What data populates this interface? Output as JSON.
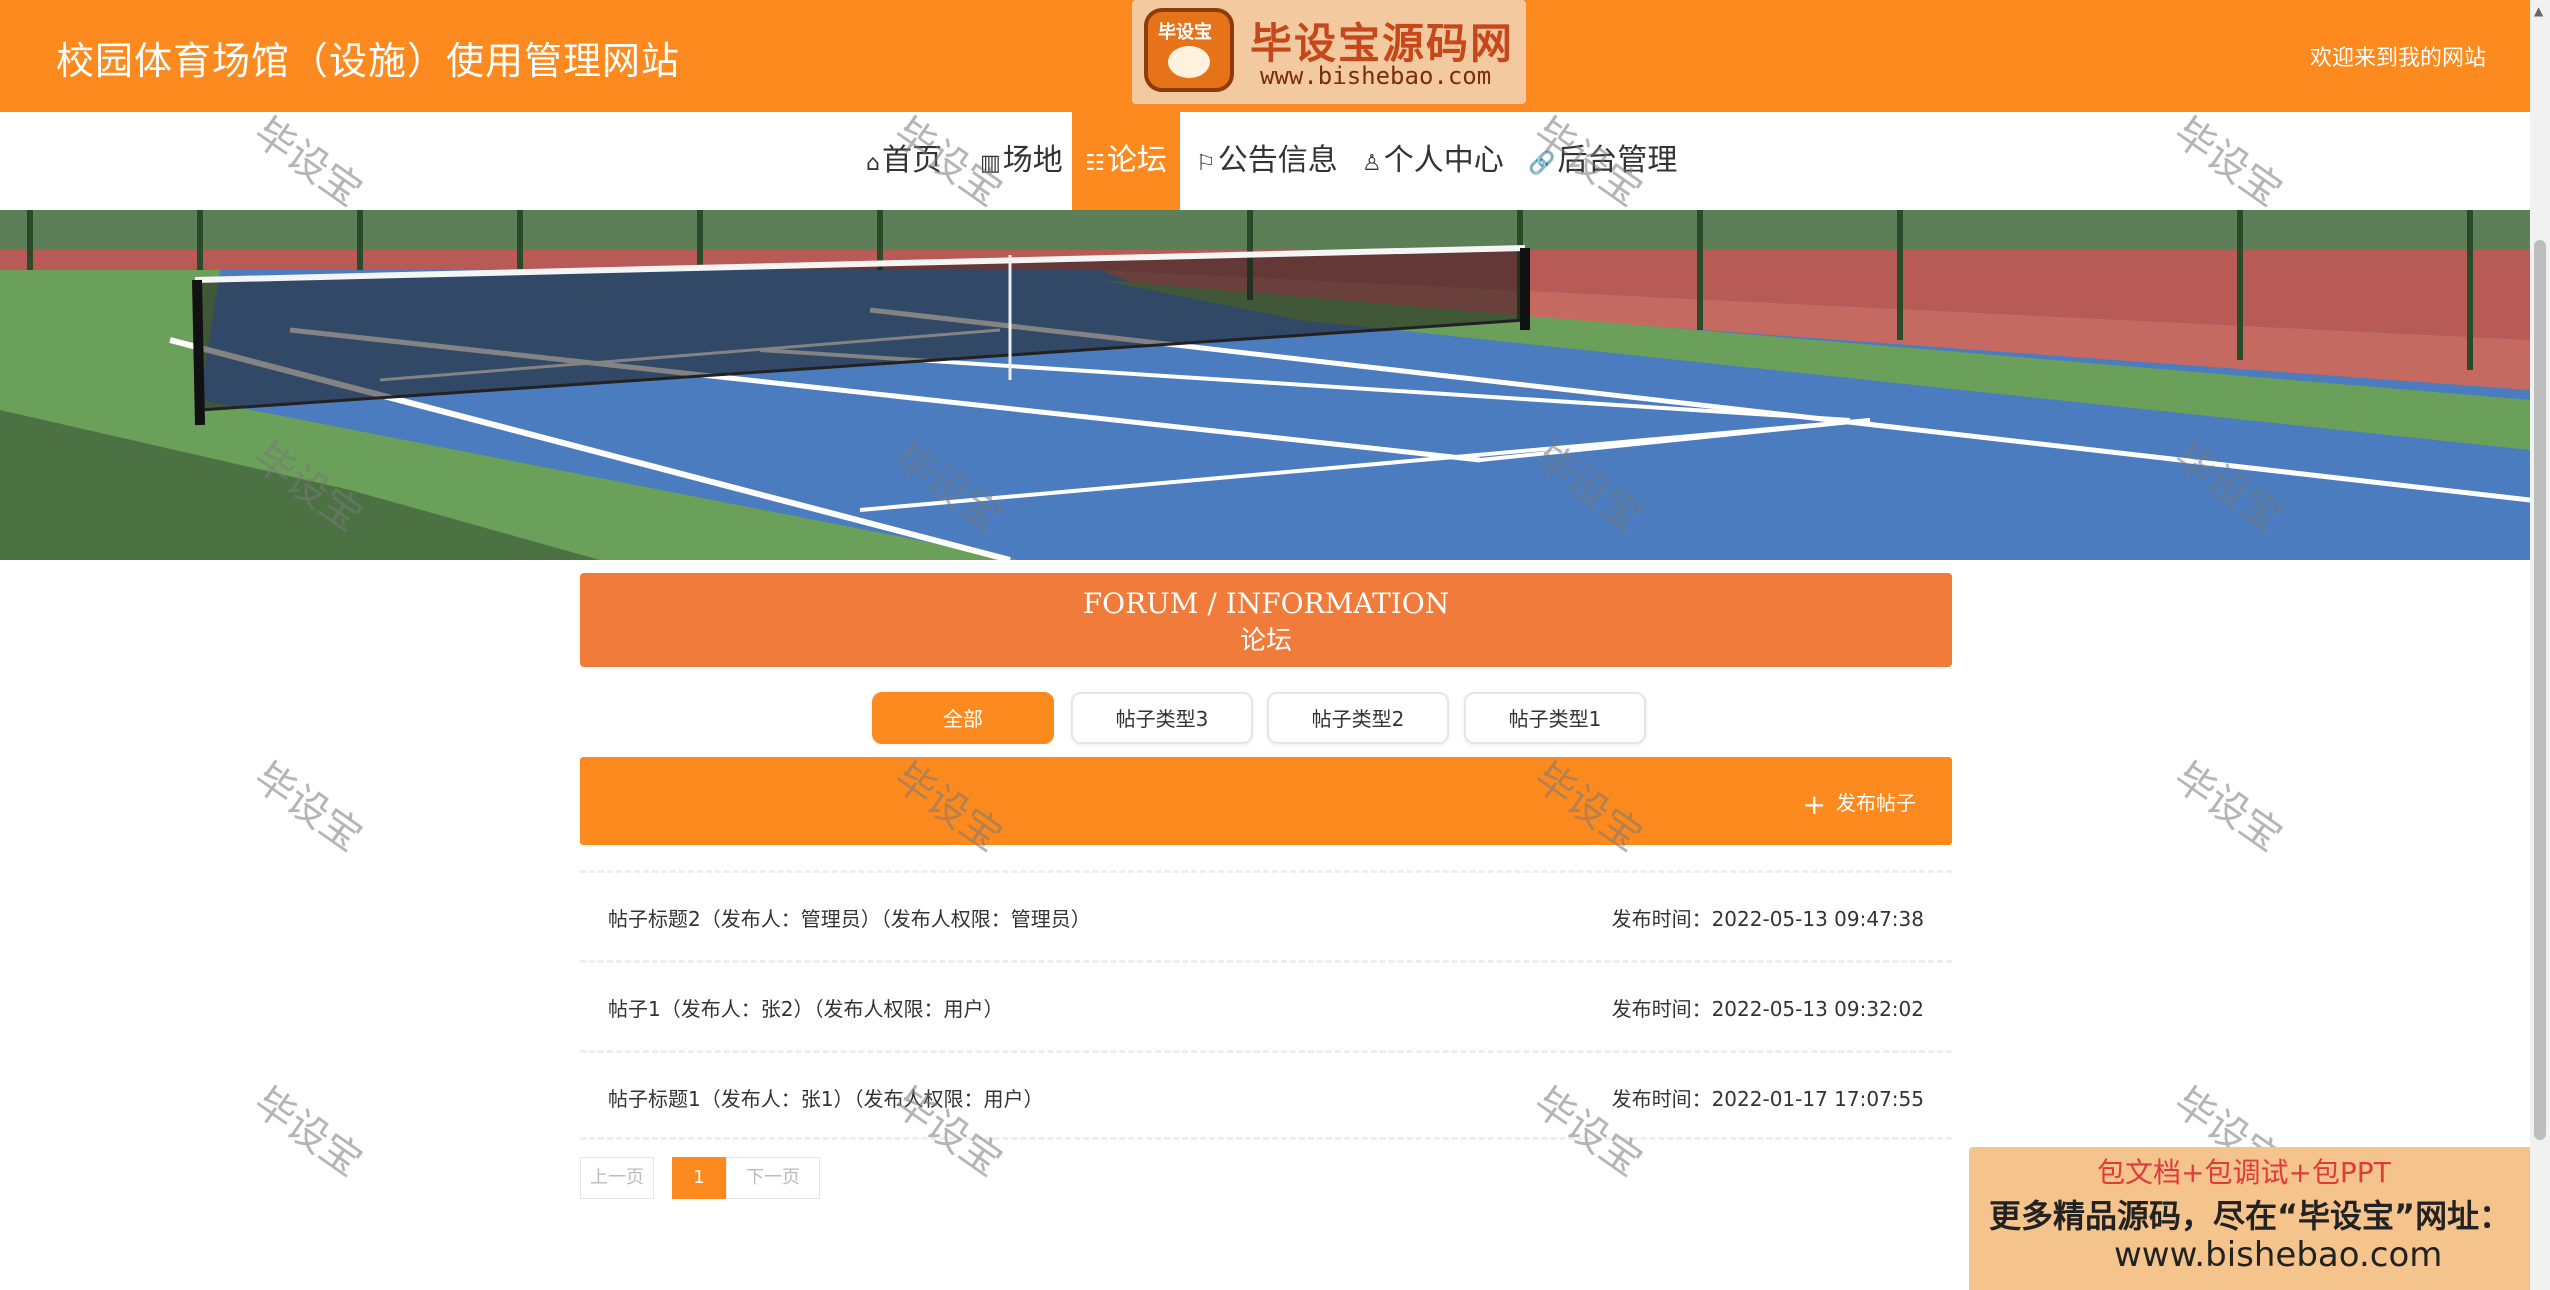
{
  "header": {
    "site_title": "校园体育场馆（设施）使用管理网站",
    "welcome": "欢迎来到我的网站"
  },
  "logo": {
    "badge_text": "毕设宝",
    "name": "毕设宝源码网",
    "url": "www.bishebao.com"
  },
  "nav": {
    "items": [
      {
        "label": "首页",
        "icon": "home-icon"
      },
      {
        "label": "场地",
        "icon": "venue-icon"
      },
      {
        "label": "论坛",
        "icon": "forum-icon",
        "active": true
      },
      {
        "label": "公告信息",
        "icon": "flag-icon"
      },
      {
        "label": "个人中心",
        "icon": "user-icon"
      },
      {
        "label": "后台管理",
        "icon": "link-icon"
      }
    ]
  },
  "banner": {
    "image": "tennis-court-photo",
    "slide_count": 2,
    "active_slide": 1
  },
  "forum": {
    "heading_en": "FORUM / INFORMATION",
    "heading_cn": "论坛",
    "tabs": [
      "全部",
      "帖子类型3",
      "帖子类型2",
      "帖子类型1"
    ],
    "active_tab": "全部",
    "post_button": "发布帖子",
    "posts": [
      {
        "title": "帖子标题2（发布人：管理员）（发布人权限：管理员）",
        "time": "发布时间：2022-05-13 09:47:38"
      },
      {
        "title": "帖子1（发布人：张2）（发布人权限：用户）",
        "time": "发布时间：2022-05-13 09:32:02"
      },
      {
        "title": "帖子标题1（发布人：张1）（发布人权限：用户）",
        "time": "发布时间：2022-01-17 17:07:55"
      }
    ],
    "pager": {
      "prev": "上一页",
      "current": "1",
      "next": "下一页"
    }
  },
  "watermark": "毕设宝",
  "ad": {
    "line1": "包文档+包调试+包PPT",
    "line2": "更多精品源码，尽在“毕设宝”网址：",
    "line3": "www.bishebao.com"
  },
  "colors": {
    "primary": "#fd8a1e",
    "forum_heading": "#f07b3a",
    "court_blue": "#4c7fc1",
    "court_green": "#6aa05a"
  }
}
